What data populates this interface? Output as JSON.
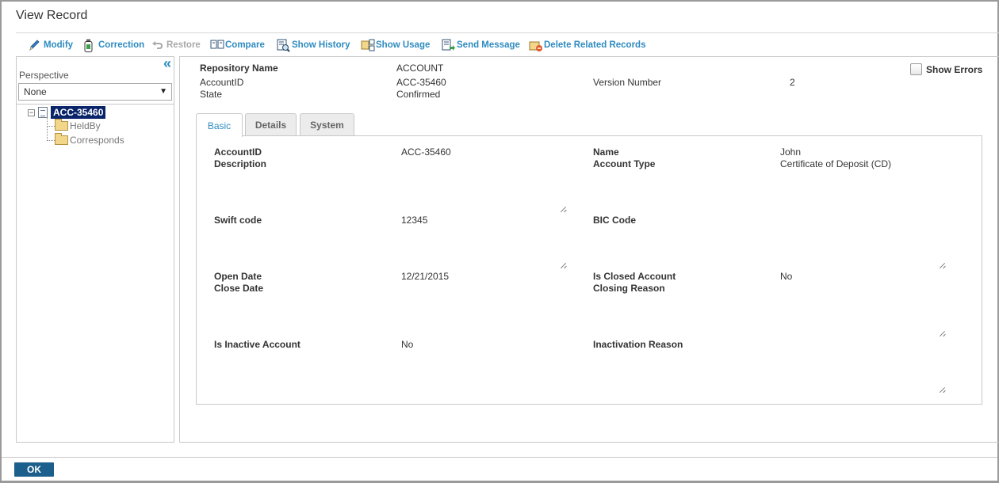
{
  "window": {
    "title": "View Record"
  },
  "toolbar": {
    "modify": "Modify",
    "correction": "Correction",
    "restore": "Restore",
    "compare": "Compare",
    "show_history": "Show History",
    "show_usage": "Show Usage",
    "send_message": "Send Message",
    "delete_related": "Delete Related Records"
  },
  "perspective": {
    "label": "Perspective",
    "value": "None"
  },
  "tree": {
    "root": "ACC-35460",
    "children": [
      "HeldBy",
      "Corresponds"
    ]
  },
  "header": {
    "repository_name_label": "Repository Name",
    "repository_name_value": "ACCOUNT",
    "account_id_label": "AccountID",
    "account_id_value": "ACC-35460",
    "state_label": "State",
    "state_value": "Confirmed",
    "version_label": "Version Number",
    "version_value": "2",
    "show_errors": "Show Errors"
  },
  "tabs": [
    "Basic",
    "Details",
    "System"
  ],
  "fields": {
    "account_id_label": "AccountID",
    "account_id_value": "ACC-35460",
    "description_label": "Description",
    "name_label": "Name",
    "name_value": "John",
    "account_type_label": "Account Type",
    "account_type_value": "Certificate of Deposit (CD)",
    "swift_label": "Swift code",
    "swift_value": "12345",
    "bic_label": "BIC Code",
    "open_date_label": "Open Date",
    "open_date_value": "12/21/2015",
    "close_date_label": "Close Date",
    "is_closed_label": "Is Closed Account",
    "is_closed_value": "No",
    "closing_reason_label": "Closing Reason",
    "is_inactive_label": "Is Inactive Account",
    "is_inactive_value": "No",
    "inactivation_reason_label": "Inactivation Reason"
  },
  "footer": {
    "ok": "OK"
  },
  "colors": {
    "link": "#2e8bc0",
    "selection": "#0a246a",
    "ok_button": "#1c5f8c"
  }
}
